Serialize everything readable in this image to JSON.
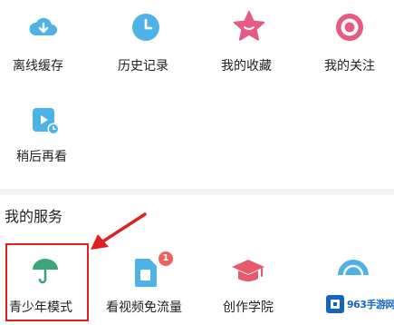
{
  "grid_top": [
    {
      "id": "offline-cache",
      "label": "离线缓存",
      "icon": "cloud-download-icon",
      "color": "#4fb2e6"
    },
    {
      "id": "history",
      "label": "历史记录",
      "icon": "clock-icon",
      "color": "#4fb2e6"
    },
    {
      "id": "favorites",
      "label": "我的收藏",
      "icon": "star-icon",
      "color": "#e65a83"
    },
    {
      "id": "following",
      "label": "我的关注",
      "icon": "target-icon",
      "color": "#e65a83"
    },
    {
      "id": "watch-later",
      "label": "稍后再看",
      "icon": "video-play-icon",
      "color": "#4fb2e6"
    }
  ],
  "services": {
    "title": "我的服务",
    "items": [
      {
        "id": "teen-mode",
        "label": "青少年模式",
        "icon": "umbrella-icon",
        "color": "#3aa679"
      },
      {
        "id": "free-data",
        "label": "看视频免流量",
        "icon": "sim-card-icon",
        "color": "#4fb2e6",
        "badge": "1"
      },
      {
        "id": "creator-academy",
        "label": "创作学院",
        "icon": "graduation-cap-icon",
        "color": "#e65a6b"
      },
      {
        "id": "partial-service",
        "label": "",
        "icon": "semicircle-icon",
        "color": "#4fb2e6"
      }
    ]
  },
  "watermark": {
    "text": "963手游网"
  },
  "colors": {
    "highlight": "#e02020",
    "arrow": "#e02020",
    "blue": "#4fb2e6",
    "pink": "#e65a83"
  }
}
